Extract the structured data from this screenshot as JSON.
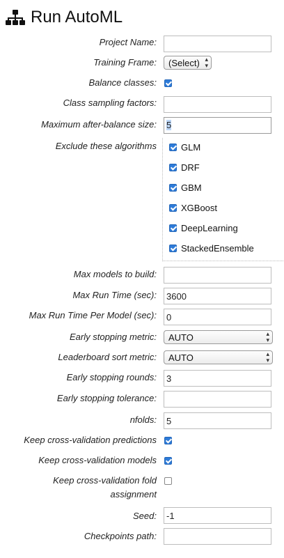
{
  "page": {
    "title": "Run AutoML",
    "title_icon": "sitemap-icon"
  },
  "colors": {
    "checkbox_checked": "#2e7bd8",
    "input_border": "#bdbdbd",
    "selection_highlight": "#bcd6f7"
  },
  "form": {
    "project_name": {
      "label": "Project Name:",
      "value": ""
    },
    "training_frame": {
      "label": "Training Frame:",
      "value": "(Select)"
    },
    "balance_classes": {
      "label": "Balance classes:",
      "checked": true
    },
    "class_sampling_factors": {
      "label": "Class sampling factors:",
      "value": ""
    },
    "max_after_balance_size": {
      "label": "Maximum after-balance size:",
      "value": "5"
    },
    "exclude_algorithms": {
      "label": "Exclude these algorithms",
      "items": [
        {
          "name": "GLM",
          "checked": true
        },
        {
          "name": "DRF",
          "checked": true
        },
        {
          "name": "GBM",
          "checked": true
        },
        {
          "name": "XGBoost",
          "checked": true
        },
        {
          "name": "DeepLearning",
          "checked": true
        },
        {
          "name": "StackedEnsemble",
          "checked": true
        }
      ]
    },
    "max_models": {
      "label": "Max models to build:",
      "value": ""
    },
    "max_run_time": {
      "label": "Max Run Time (sec):",
      "value": "3600"
    },
    "max_run_time_per_model": {
      "label": "Max Run Time Per Model (sec):",
      "value": "0"
    },
    "early_stopping_metric": {
      "label": "Early stopping metric:",
      "value": "AUTO"
    },
    "leaderboard_sort_metric": {
      "label": "Leaderboard sort metric:",
      "value": "AUTO"
    },
    "early_stopping_rounds": {
      "label": "Early stopping rounds:",
      "value": "3"
    },
    "early_stopping_tolerance": {
      "label": "Early stopping tolerance:",
      "value": ""
    },
    "nfolds": {
      "label": "nfolds:",
      "value": "5"
    },
    "keep_cv_predictions": {
      "label": "Keep cross-validation predictions",
      "checked": true
    },
    "keep_cv_models": {
      "label": "Keep cross-validation models",
      "checked": true
    },
    "keep_cv_fold_assignment": {
      "label": "Keep cross-validation fold assignment",
      "checked": false
    },
    "seed": {
      "label": "Seed:",
      "value": "-1"
    },
    "checkpoints_path": {
      "label": "Checkpoints path:",
      "value": ""
    }
  }
}
